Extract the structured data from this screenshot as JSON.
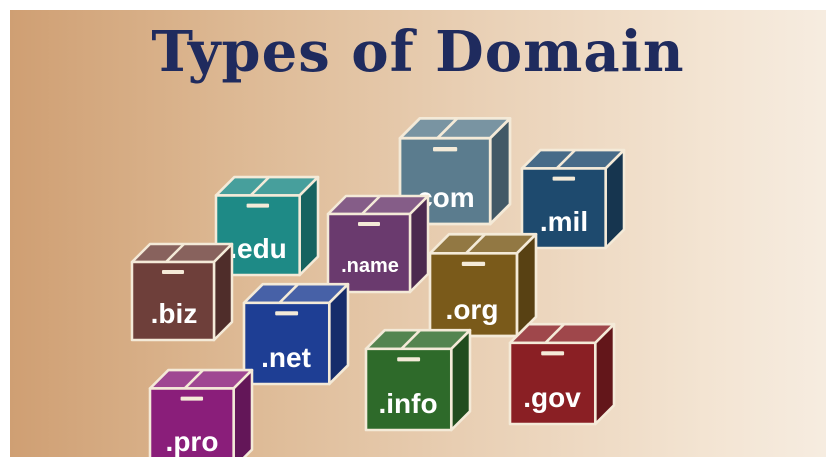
{
  "title": "Types of Domain",
  "colors": {
    "title": "#1f2b5e",
    "com": "#5b7c8e",
    "mil": "#1e4a6e",
    "edu": "#1e8a86",
    "name": "#6a3a6e",
    "org": "#7a5a1a",
    "biz": "#6e3f3a",
    "net": "#1e3e94",
    "info": "#2e6a2a",
    "gov": "#8a1f24",
    "pro": "#8a1e7a"
  },
  "boxes": {
    "com": {
      "label": ".com",
      "icon": "box-icon"
    },
    "mil": {
      "label": ".mil",
      "icon": "box-icon"
    },
    "edu": {
      "label": ".edu",
      "icon": "box-icon"
    },
    "name": {
      "label": ".name",
      "icon": "box-icon"
    },
    "org": {
      "label": ".org",
      "icon": "box-icon"
    },
    "biz": {
      "label": ".biz",
      "icon": "box-icon"
    },
    "net": {
      "label": ".net",
      "icon": "box-icon"
    },
    "info": {
      "label": ".info",
      "icon": "box-icon"
    },
    "gov": {
      "label": ".gov",
      "icon": "box-icon"
    },
    "pro": {
      "label": ".pro",
      "icon": "box-icon"
    }
  }
}
